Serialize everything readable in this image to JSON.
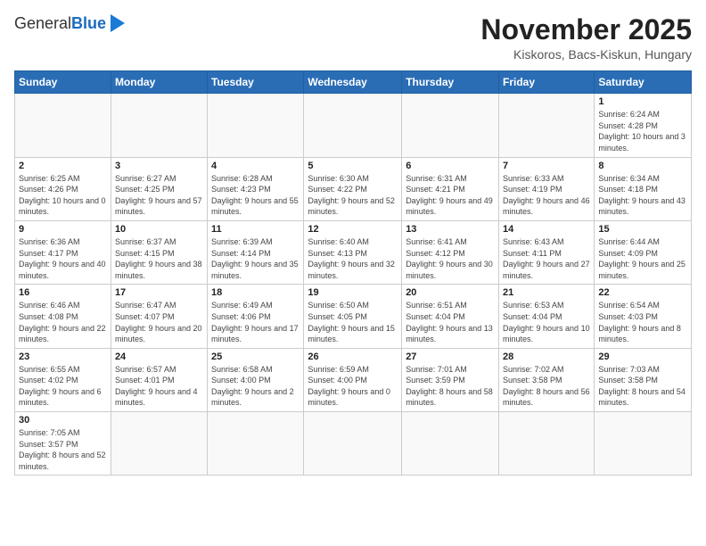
{
  "header": {
    "logo_general": "General",
    "logo_blue": "Blue",
    "month_title": "November 2025",
    "location": "Kiskoros, Bacs-Kiskun, Hungary"
  },
  "weekdays": [
    "Sunday",
    "Monday",
    "Tuesday",
    "Wednesday",
    "Thursday",
    "Friday",
    "Saturday"
  ],
  "weeks": [
    [
      {
        "day": "",
        "info": ""
      },
      {
        "day": "",
        "info": ""
      },
      {
        "day": "",
        "info": ""
      },
      {
        "day": "",
        "info": ""
      },
      {
        "day": "",
        "info": ""
      },
      {
        "day": "",
        "info": ""
      },
      {
        "day": "1",
        "info": "Sunrise: 6:24 AM\nSunset: 4:28 PM\nDaylight: 10 hours\nand 3 minutes."
      }
    ],
    [
      {
        "day": "2",
        "info": "Sunrise: 6:25 AM\nSunset: 4:26 PM\nDaylight: 10 hours\nand 0 minutes."
      },
      {
        "day": "3",
        "info": "Sunrise: 6:27 AM\nSunset: 4:25 PM\nDaylight: 9 hours\nand 57 minutes."
      },
      {
        "day": "4",
        "info": "Sunrise: 6:28 AM\nSunset: 4:23 PM\nDaylight: 9 hours\nand 55 minutes."
      },
      {
        "day": "5",
        "info": "Sunrise: 6:30 AM\nSunset: 4:22 PM\nDaylight: 9 hours\nand 52 minutes."
      },
      {
        "day": "6",
        "info": "Sunrise: 6:31 AM\nSunset: 4:21 PM\nDaylight: 9 hours\nand 49 minutes."
      },
      {
        "day": "7",
        "info": "Sunrise: 6:33 AM\nSunset: 4:19 PM\nDaylight: 9 hours\nand 46 minutes."
      },
      {
        "day": "8",
        "info": "Sunrise: 6:34 AM\nSunset: 4:18 PM\nDaylight: 9 hours\nand 43 minutes."
      }
    ],
    [
      {
        "day": "9",
        "info": "Sunrise: 6:36 AM\nSunset: 4:17 PM\nDaylight: 9 hours\nand 40 minutes."
      },
      {
        "day": "10",
        "info": "Sunrise: 6:37 AM\nSunset: 4:15 PM\nDaylight: 9 hours\nand 38 minutes."
      },
      {
        "day": "11",
        "info": "Sunrise: 6:39 AM\nSunset: 4:14 PM\nDaylight: 9 hours\nand 35 minutes."
      },
      {
        "day": "12",
        "info": "Sunrise: 6:40 AM\nSunset: 4:13 PM\nDaylight: 9 hours\nand 32 minutes."
      },
      {
        "day": "13",
        "info": "Sunrise: 6:41 AM\nSunset: 4:12 PM\nDaylight: 9 hours\nand 30 minutes."
      },
      {
        "day": "14",
        "info": "Sunrise: 6:43 AM\nSunset: 4:11 PM\nDaylight: 9 hours\nand 27 minutes."
      },
      {
        "day": "15",
        "info": "Sunrise: 6:44 AM\nSunset: 4:09 PM\nDaylight: 9 hours\nand 25 minutes."
      }
    ],
    [
      {
        "day": "16",
        "info": "Sunrise: 6:46 AM\nSunset: 4:08 PM\nDaylight: 9 hours\nand 22 minutes."
      },
      {
        "day": "17",
        "info": "Sunrise: 6:47 AM\nSunset: 4:07 PM\nDaylight: 9 hours\nand 20 minutes."
      },
      {
        "day": "18",
        "info": "Sunrise: 6:49 AM\nSunset: 4:06 PM\nDaylight: 9 hours\nand 17 minutes."
      },
      {
        "day": "19",
        "info": "Sunrise: 6:50 AM\nSunset: 4:05 PM\nDaylight: 9 hours\nand 15 minutes."
      },
      {
        "day": "20",
        "info": "Sunrise: 6:51 AM\nSunset: 4:04 PM\nDaylight: 9 hours\nand 13 minutes."
      },
      {
        "day": "21",
        "info": "Sunrise: 6:53 AM\nSunset: 4:04 PM\nDaylight: 9 hours\nand 10 minutes."
      },
      {
        "day": "22",
        "info": "Sunrise: 6:54 AM\nSunset: 4:03 PM\nDaylight: 9 hours\nand 8 minutes."
      }
    ],
    [
      {
        "day": "23",
        "info": "Sunrise: 6:55 AM\nSunset: 4:02 PM\nDaylight: 9 hours\nand 6 minutes."
      },
      {
        "day": "24",
        "info": "Sunrise: 6:57 AM\nSunset: 4:01 PM\nDaylight: 9 hours\nand 4 minutes."
      },
      {
        "day": "25",
        "info": "Sunrise: 6:58 AM\nSunset: 4:00 PM\nDaylight: 9 hours\nand 2 minutes."
      },
      {
        "day": "26",
        "info": "Sunrise: 6:59 AM\nSunset: 4:00 PM\nDaylight: 9 hours\nand 0 minutes."
      },
      {
        "day": "27",
        "info": "Sunrise: 7:01 AM\nSunset: 3:59 PM\nDaylight: 8 hours\nand 58 minutes."
      },
      {
        "day": "28",
        "info": "Sunrise: 7:02 AM\nSunset: 3:58 PM\nDaylight: 8 hours\nand 56 minutes."
      },
      {
        "day": "29",
        "info": "Sunrise: 7:03 AM\nSunset: 3:58 PM\nDaylight: 8 hours\nand 54 minutes."
      }
    ],
    [
      {
        "day": "30",
        "info": "Sunrise: 7:05 AM\nSunset: 3:57 PM\nDaylight: 8 hours\nand 52 minutes."
      },
      {
        "day": "",
        "info": ""
      },
      {
        "day": "",
        "info": ""
      },
      {
        "day": "",
        "info": ""
      },
      {
        "day": "",
        "info": ""
      },
      {
        "day": "",
        "info": ""
      },
      {
        "day": "",
        "info": ""
      }
    ]
  ]
}
